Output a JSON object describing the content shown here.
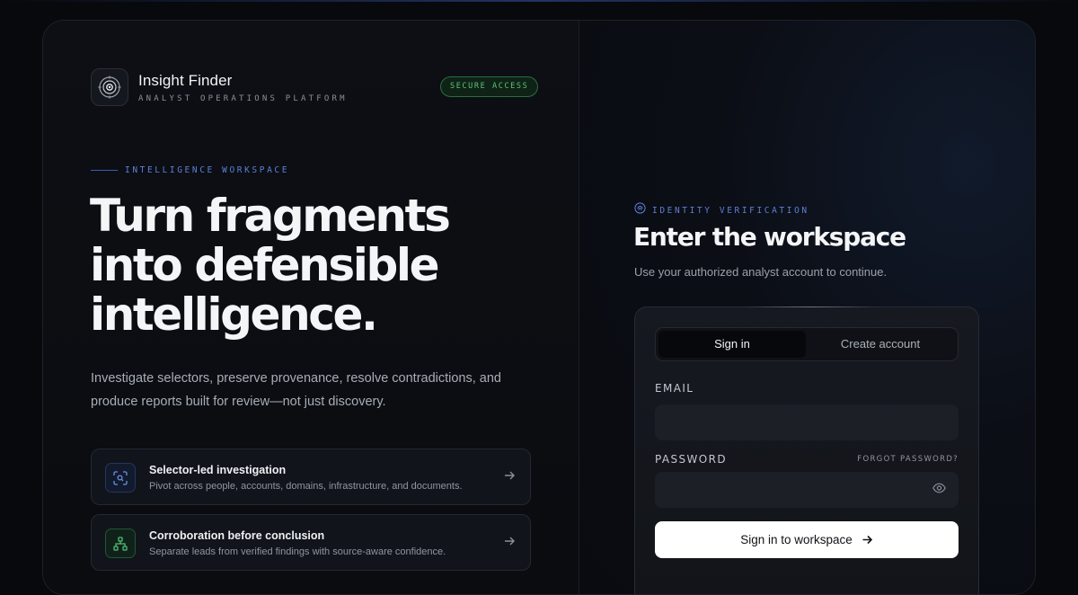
{
  "brand": {
    "name": "Insight Finder",
    "subtitle": "ANALYST OPERATIONS PLATFORM",
    "badge": "SECURE ACCESS"
  },
  "hero": {
    "kicker": "INTELLIGENCE WORKSPACE",
    "title_line1": "Turn fragments",
    "title_line2": "into defensible",
    "title_line3": "intelligence.",
    "description": "Investigate selectors, preserve provenance, resolve contradictions, and produce reports built for review—not just discovery."
  },
  "features": [
    {
      "title": "Selector-led investigation",
      "description": "Pivot across people, accounts, domains, infrastructure, and documents.",
      "icon": "scan-selector-icon"
    },
    {
      "title": "Corroboration before conclusion",
      "description": "Separate leads from verified findings with source-aware confidence.",
      "icon": "network-tree-icon"
    }
  ],
  "auth": {
    "kicker": "IDENTITY VERIFICATION",
    "title": "Enter the workspace",
    "subtitle": "Use your authorized analyst account to continue.",
    "tabs": [
      "Sign in",
      "Create account"
    ],
    "active_tab": "Sign in",
    "email_label": "EMAIL",
    "email_value": "",
    "password_label": "PASSWORD",
    "password_value": "",
    "forgot_label": "FORGOT PASSWORD?",
    "submit_label": "Sign in to workspace"
  },
  "colors": {
    "background": "#07090d",
    "accent_blue": "#5d7fd6",
    "badge_green": "#5cc37a",
    "button_bg": "#ffffff"
  }
}
